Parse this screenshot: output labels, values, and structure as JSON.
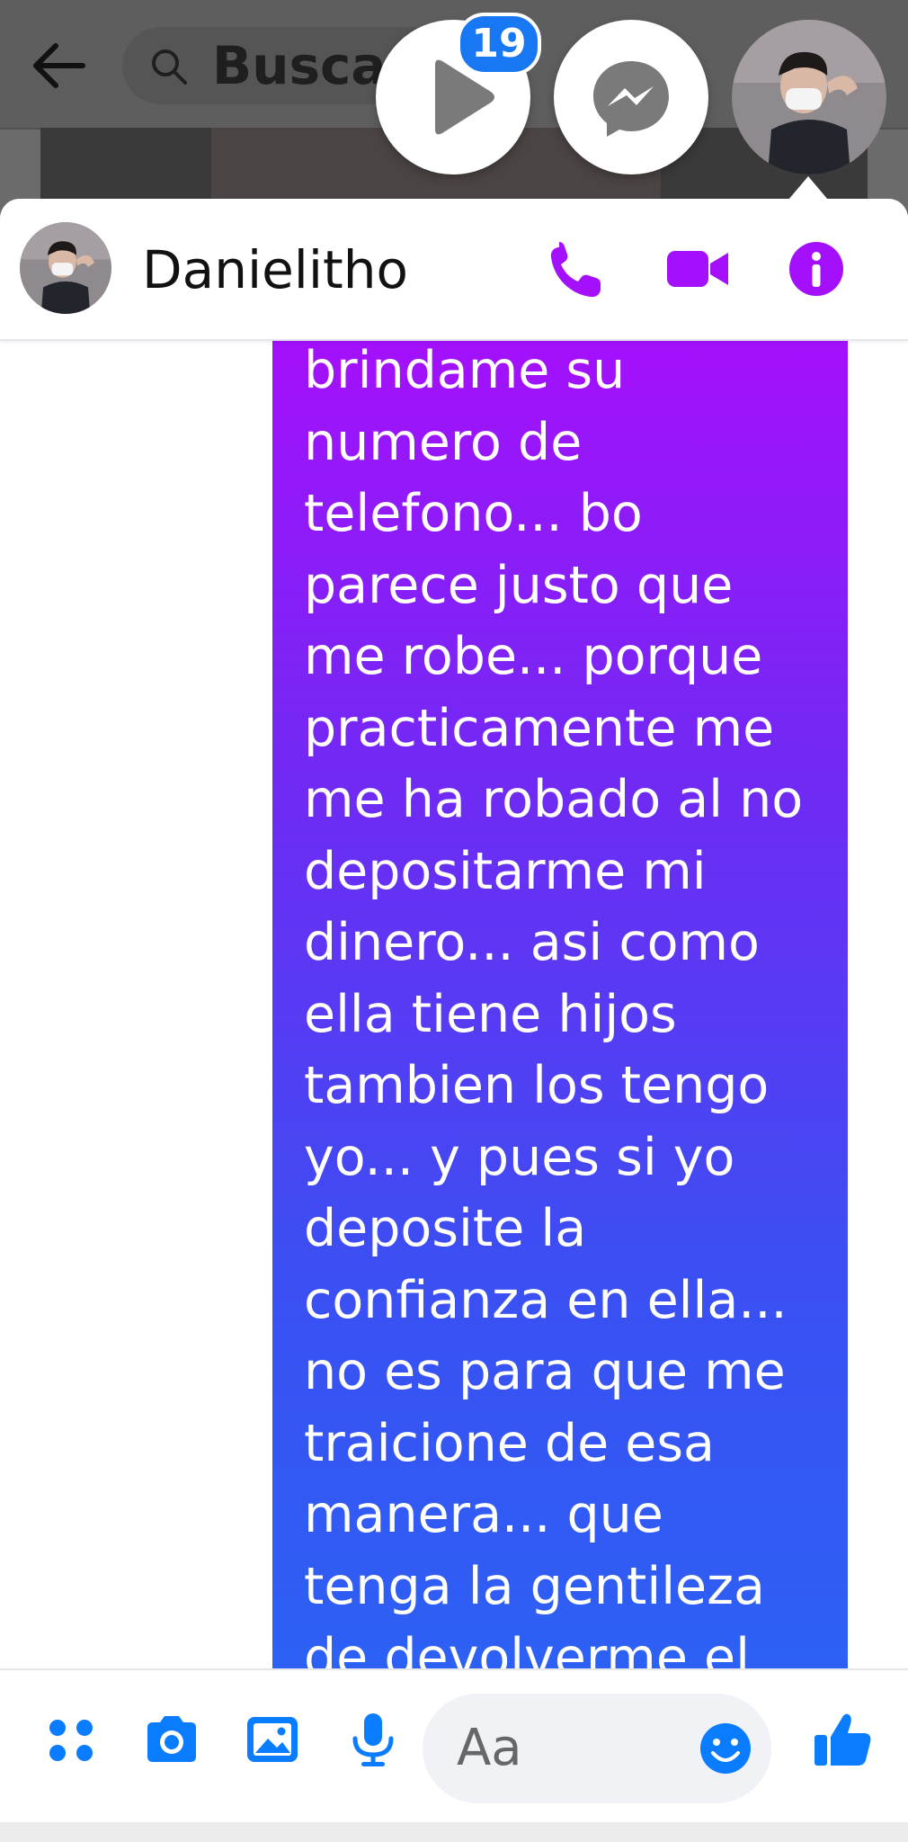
{
  "background_app": {
    "search_placeholder": "Buscar"
  },
  "chat_heads": {
    "video_badge_count": "19",
    "icons": [
      "play-icon",
      "messenger-icon"
    ]
  },
  "chat": {
    "contact_name": "Danielitho",
    "header_icons": [
      "phone-icon",
      "video-camera-icon",
      "info-icon"
    ],
    "accent_color": "#a410fb",
    "message_text": "brindame su\nnumero de\ntelefono... bo\nparece justo que\nme robe... porque\npracticamente me\nme ha robado al no\ndepositarme mi\ndinero... asi como\nella tiene hijos\ntambien los tengo\nyo... y pues si yo\ndeposite la\nconfianza en ella...\nno es para que me\ntraicione de esa\nmanera... que\ntenga la gentileza\nde devolverme el"
  },
  "composer": {
    "placeholder": "Aa",
    "icons": [
      "apps-grid-icon",
      "camera-icon",
      "gallery-icon",
      "microphone-icon",
      "emoji-icon",
      "like-thumb-icon"
    ],
    "icon_color": "#0a7cff"
  }
}
